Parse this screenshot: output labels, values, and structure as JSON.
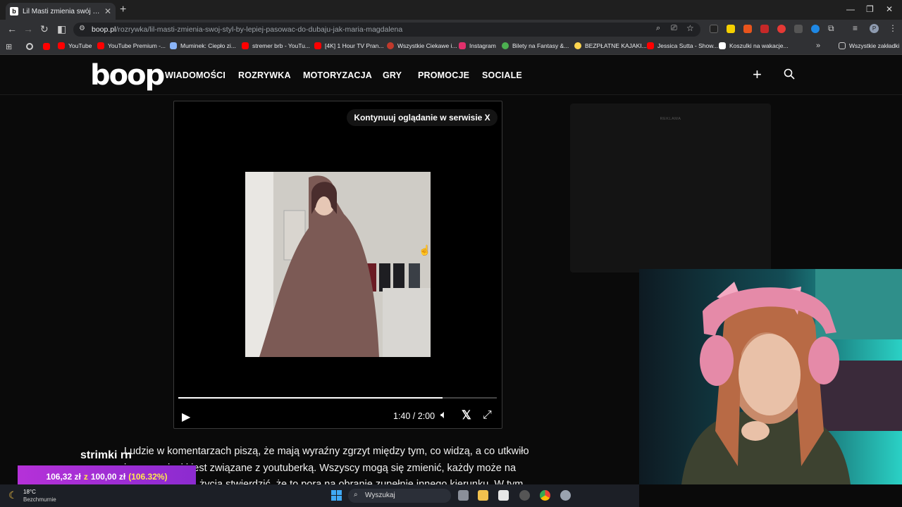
{
  "browser": {
    "tab_title": "Lil Masti zmienia swój styl, by lepiej",
    "tab_favicon": "b",
    "url_domain": "boop.pl",
    "url_path": "/rozrywka/lil-masti-zmienia-swoj-styl-by-lepiej-pasowac-do-dubaju-jak-maria-magdalena",
    "bookmarks": [
      {
        "label": "YouTube",
        "color": "#ff0000"
      },
      {
        "label": "YouTube Premium -...",
        "color": "#ff0000"
      },
      {
        "label": "Muminek: Ciepło zi...",
        "color": "#8ab4f8"
      },
      {
        "label": "stremer brb - YouTu...",
        "color": "#ff0000"
      },
      {
        "label": "[4K] 1 Hour TV Pran...",
        "color": "#ff0000"
      },
      {
        "label": "Wszystkie Ciekawe i...",
        "color": "#c0392b"
      },
      {
        "label": "Instagram",
        "color": "#e1306c"
      },
      {
        "label": "Bilety na Fantasy &...",
        "color": "#4caf50"
      },
      {
        "label": "BEZPŁATNE KAJAKI...",
        "color": "#ffd54f"
      },
      {
        "label": "Jessica Sutta - Show...",
        "color": "#ff0000"
      },
      {
        "label": "Koszulki na wakacje...",
        "color": "#ffffff"
      }
    ],
    "all_bookmarks": "Wszystkie zakładki"
  },
  "site": {
    "logo": "boop",
    "nav": [
      "WIADOMOŚCI",
      "ROZRYWKA",
      "MOTORYZACJA",
      "GRY",
      "PROMOCJE",
      "SOCIALE"
    ]
  },
  "embed": {
    "continue_label": "Kontynuuj oglądanie w serwisie X",
    "time": "1:40 / 2:00",
    "progress": 0.83
  },
  "ad": {
    "label": "REKLAMA"
  },
  "article": {
    "lines": [
      "Ludzie w komentarzach piszą, że mają wyraźny zgrzyt między tym, co widzą, a co utkwiło",
      "im w pamięci i jest związane z youtuberką. Wszyscy mogą się zmienić, każdy może na",
      "życia stwierdzić, że to pora na obranie zupełnie innego kierunku. W tym"
    ]
  },
  "stream": {
    "title": "strimki rn",
    "donation_current": "106,32 zł",
    "donation_sep": "z",
    "donation_goal": "100,00 zł",
    "donation_percent": "(106.32%)"
  },
  "taskbar": {
    "temperature": "18°C",
    "weather": "Bezchmurnie",
    "search_placeholder": "Wyszukaj"
  }
}
